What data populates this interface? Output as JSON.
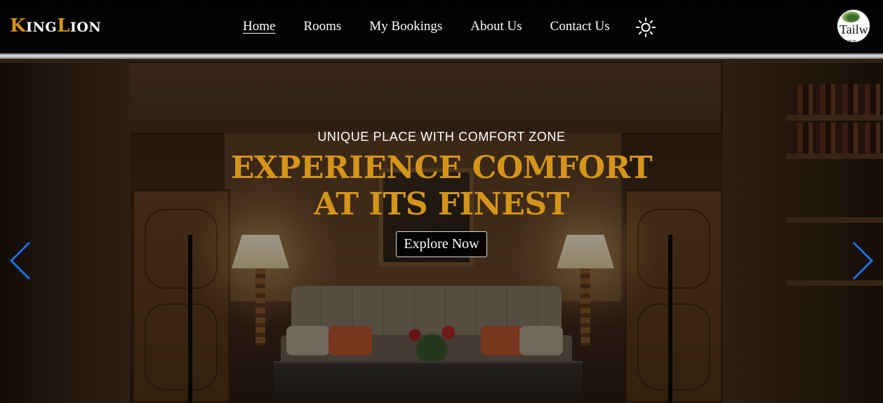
{
  "brand": {
    "name_k": "K",
    "name_ing": "ING",
    "name_l": "L",
    "name_ion": "ION",
    "accent": "#d4951a"
  },
  "nav": {
    "items": [
      {
        "label": "Home",
        "active": true
      },
      {
        "label": "Rooms"
      },
      {
        "label": "My Bookings"
      },
      {
        "label": "About Us"
      },
      {
        "label": "Contact Us"
      }
    ],
    "theme_icon": "sun-icon"
  },
  "avatar": {
    "alt_text": "Tailw"
  },
  "hero": {
    "subtitle": "UNIQUE PLACE WITH COMFORT ZONE",
    "headline_line1": "EXPERIENCE COMFORT",
    "headline_line2": "AT ITS FINEST",
    "cta_label": "Explore Now"
  },
  "carousel": {
    "prev_icon": "chevron-left-icon",
    "next_icon": "chevron-right-icon",
    "arrow_color": "#1e6fe0"
  }
}
